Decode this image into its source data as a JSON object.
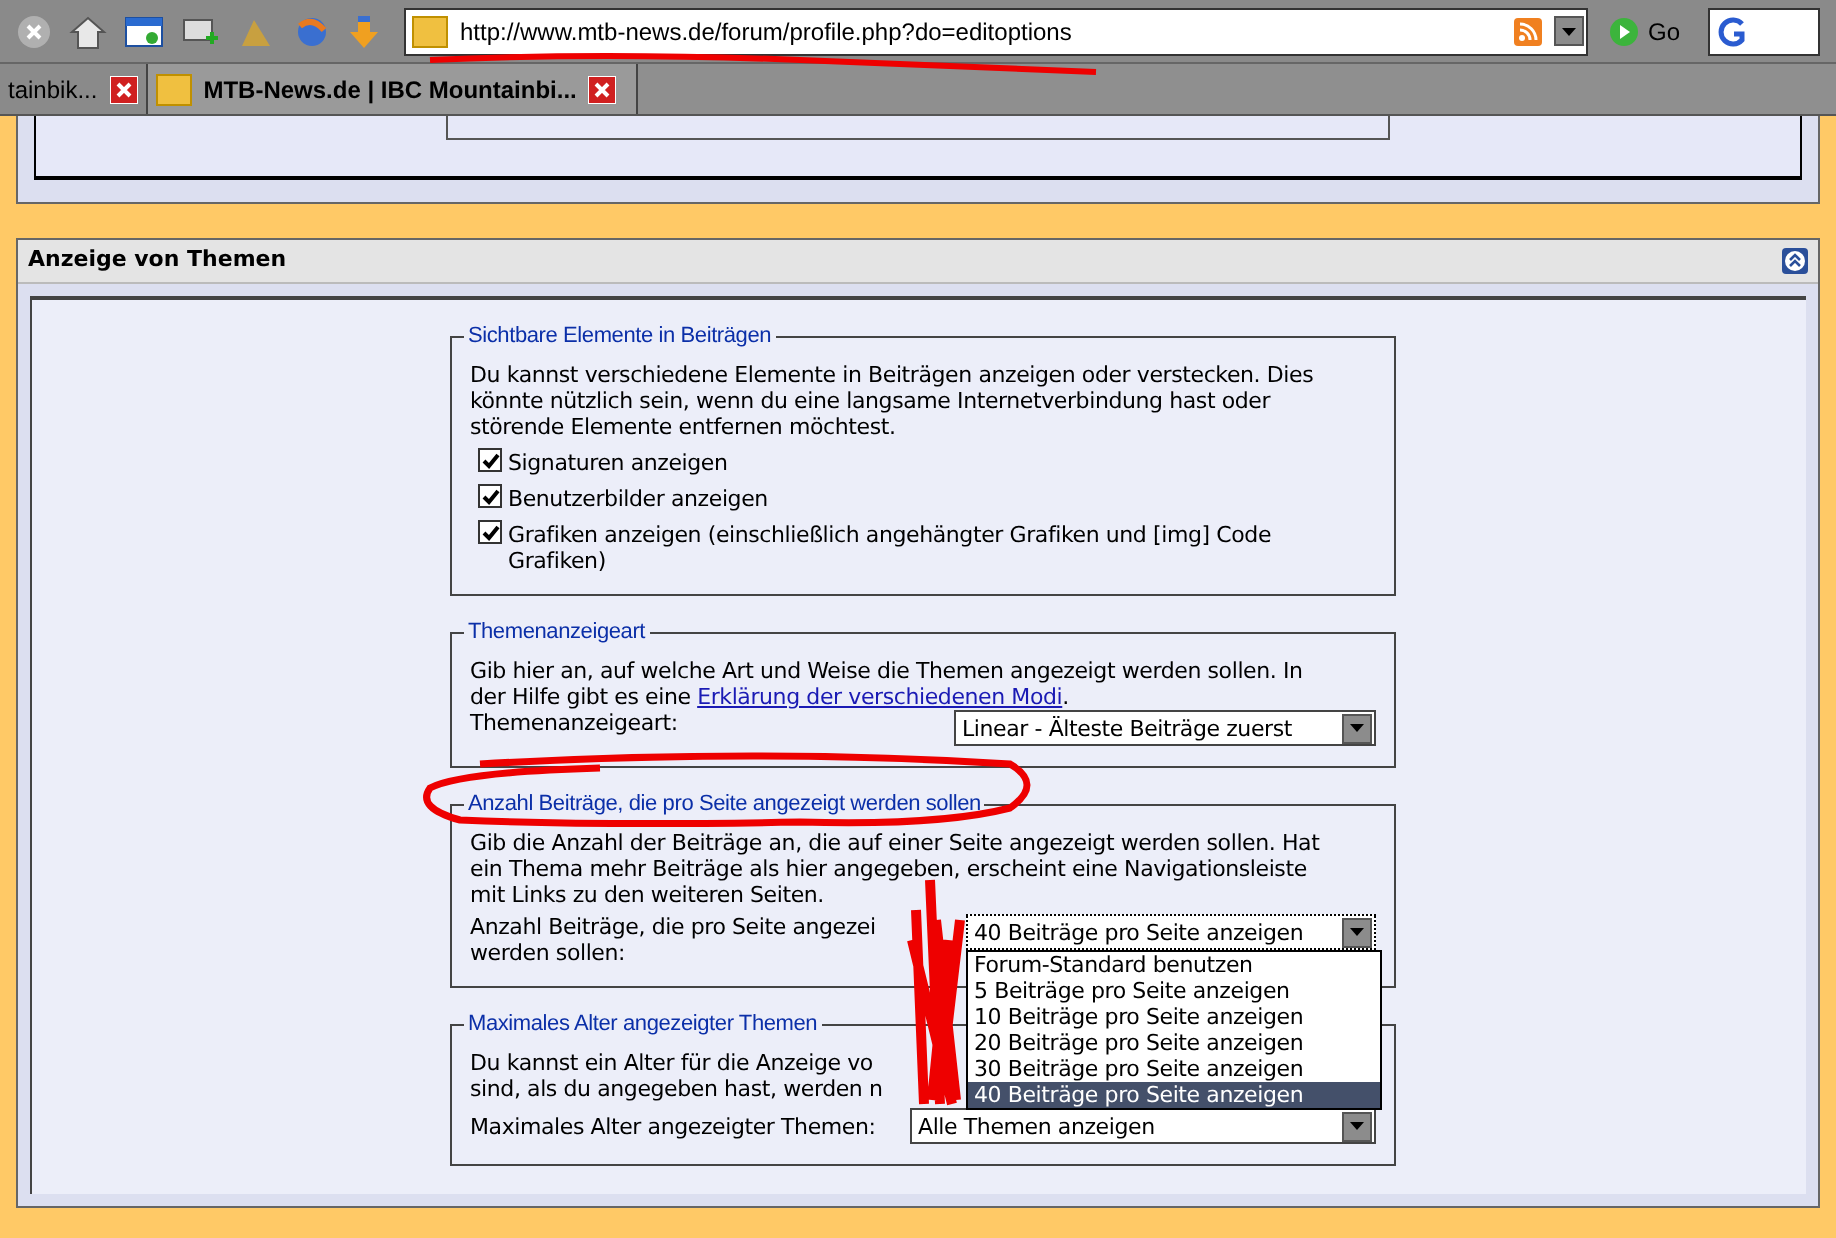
{
  "browser": {
    "url": "http://www.mtb-news.de/forum/profile.php?do=editoptions",
    "go_label": "Go",
    "tabs": [
      {
        "label": "tainbik...",
        "selected": false
      },
      {
        "label": "MTB-News.de | IBC Mountainbi...",
        "selected": true
      }
    ]
  },
  "section": {
    "title": "Anzeige von Themen",
    "fieldsets": [
      {
        "kind": "checkboxes",
        "legend": "Sichtbare Elemente in Beiträgen",
        "description": "Du kannst verschiedene Elemente in Beiträgen anzeigen oder verstecken. Dies könnte nützlich sein, wenn du eine langsame Internetverbindung hast oder störende Elemente entfernen möchtest.",
        "options": [
          {
            "label": "Signaturen anzeigen",
            "checked": true
          },
          {
            "label": "Benutzerbilder anzeigen",
            "checked": true
          },
          {
            "label": "Grafiken anzeigen (einschließlich angehängter Grafiken und [img] Code Grafiken)",
            "checked": true
          }
        ]
      },
      {
        "kind": "select",
        "legend": "Themenanzeigeart",
        "description": "Gib hier an, auf welche Art und Weise die Themen angezeigt werden sollen. In der Hilfe gibt es eine ",
        "link": "Erklärung der verschiedenen Modi",
        "description_end": ".",
        "field_label": "Themenanzeigeart:",
        "value": "Linear - Älteste Beiträge zuerst",
        "expanded": false
      },
      {
        "kind": "select",
        "legend": "Anzahl Beiträge, die pro Seite angezeigt werden sollen",
        "description": "Gib die Anzahl der Beiträge an, die auf einer Seite angezeigt werden sollen. Hat ein Thema mehr Beiträge als hier angegeben, erscheint eine Navigationsleiste mit Links zu den weiteren Seiten.",
        "field_label": "Anzahl Beiträge, die pro Seite angezei werden sollen:",
        "value": "40 Beiträge pro Seite anzeigen",
        "expanded": true,
        "options": [
          {
            "label": "Forum-Standard benutzen",
            "selected": false
          },
          {
            "label": "5 Beiträge pro Seite anzeigen",
            "selected": false
          },
          {
            "label": "10 Beiträge pro Seite anzeigen",
            "selected": false
          },
          {
            "label": "20 Beiträge pro Seite anzeigen",
            "selected": false
          },
          {
            "label": "30 Beiträge pro Seite anzeigen",
            "selected": false
          },
          {
            "label": "40 Beiträge pro Seite anzeigen",
            "selected": true
          }
        ]
      },
      {
        "kind": "select",
        "legend": "Maximales Alter angezeigter Themen",
        "description": "Du kannst ein Alter für die Anzeige vo",
        "description_line2": "sind, als du angegeben hast, werden n",
        "field_label": "Maximales Alter angezeigter Themen:",
        "value": "Alle Themen anzeigen",
        "expanded": false
      }
    ]
  },
  "annotations": [
    {
      "kind": "underline"
    },
    {
      "kind": "ellipse"
    },
    {
      "kind": "scribble"
    }
  ]
}
